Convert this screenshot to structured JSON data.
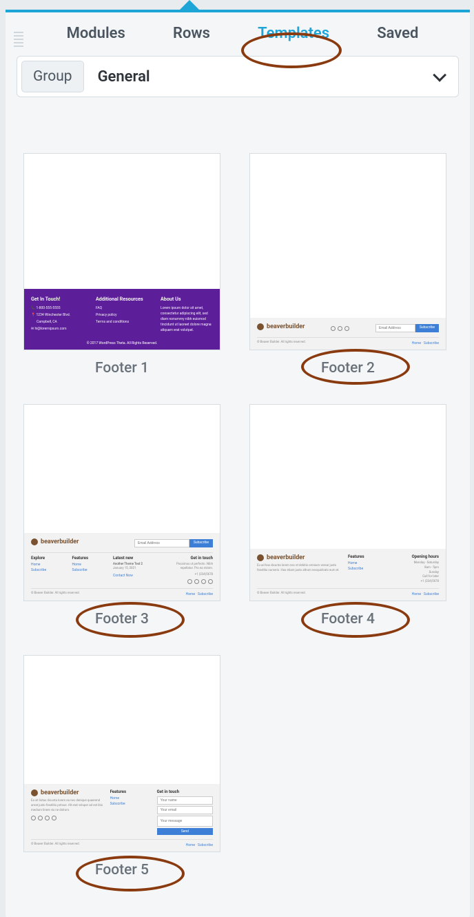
{
  "tabs": {
    "modules": "Modules",
    "rows": "Rows",
    "templates": "Templates",
    "saved": "Saved"
  },
  "group": {
    "label": "Group",
    "selected": "General"
  },
  "templates": {
    "footer1": {
      "title": "Footer 1",
      "col1_heading": "Get In Touch!",
      "phone": "1-800-555-5555",
      "address1": "1234 Winchester Blvd.",
      "address2": "Campbell, CA",
      "email": "hi@loremipsum.com",
      "col2_heading": "Additional Resources",
      "faq": "FAQ",
      "privacy": "Privacy policy",
      "terms": "Terms and conditions",
      "col3_heading": "About Us",
      "about_text": "Lorem ipsum dolor sit amet, consectetur adipiscing elit, sed diam nonummy nibh euismod tincidunt ut laoreet dolore magna aliquam erat volutpat.",
      "copyright": "© 2017 WordPress Theta. All Rights Reserved."
    },
    "footer2": {
      "title": "Footer 2",
      "brand": "beaverbuilder",
      "email_placeholder": "Email Address",
      "subscribe": "Subscribe",
      "copyright": "© Beaver Builder. All rights reserved.",
      "link_home": "Home",
      "link_sub": "Subscribe"
    },
    "footer3": {
      "title": "Footer 3",
      "brand": "beaverbuilder",
      "email_placeholder": "Email Address",
      "subscribe": "Subscribe",
      "col1_h": "Explore",
      "col1_a": "Home",
      "col1_b": "Subscribe",
      "col2_h": "Features",
      "col2_a": "Home",
      "col2_b": "Subscribe",
      "col3_h": "Latest new",
      "col3_a": "Another Theme Test 2",
      "col3_b": "January 15, 2021",
      "col3_c": "Contact Now",
      "col4_h": "Get in touch",
      "col4_text": "Possimus ut perfecto. Nibh repellatur. Pro ea minim.",
      "phone": "+1 (234)5678",
      "copyright": "© Beaver Builder. All rights reserved.",
      "link_home": "Home",
      "link_sub": "Subscribe"
    },
    "footer4": {
      "title": "Footer 4",
      "brand": "beaverbuilder",
      "about_text": "Eu ad has dicunta lorem nec et debitis omnium verear justo feselitis numeris. Has etiam justo altrum necquidcats eum et.",
      "col2_h": "Features",
      "col2_a": "Home",
      "col2_b": "Subscribe",
      "col3_h": "Opening hours",
      "hours1": "Monday - Saturday",
      "hours1v": "8am - 5pm",
      "hours2": "Sunday",
      "hours3": "Call for later",
      "phone": "+1 (234)5678",
      "copyright": "© Beaver Builder. All rights reserved.",
      "link_home": "Home",
      "link_sub": "Subscribe"
    },
    "footer5": {
      "title": "Footer 5",
      "brand": "beaverbuilder",
      "about_text": "Ea sit listas dicunta lorem ea nec denique quaerend amat justo feselitis pntsue. Alt erat veluper ad est ibis medium linere vix ne dstrum.",
      "col2_h": "Features",
      "col2_a": "Home",
      "col2_b": "Subscribe",
      "col3_h": "Get in touch",
      "ph_name": "Your name",
      "ph_email": "Your email",
      "ph_msg": "Your message",
      "send": "Send",
      "copyright": "© Beaver Builder. All rights reserved.",
      "link_home": "Home",
      "link_sub": "Subscribe"
    }
  }
}
